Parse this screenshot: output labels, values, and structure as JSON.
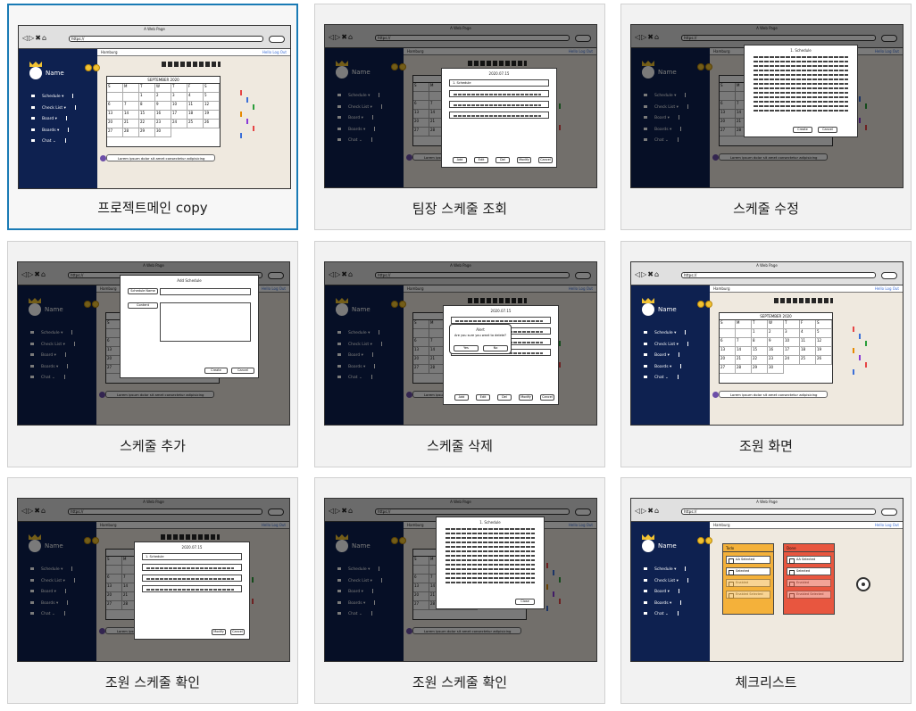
{
  "thumbs": [
    {
      "caption": "프로젝트메인 copy",
      "variant": "main",
      "selected": true
    },
    {
      "caption": "팀장 스케줄 조회",
      "variant": "list-dialog",
      "selected": false
    },
    {
      "caption": "스케줄 수정",
      "variant": "edit-dialog",
      "selected": false
    },
    {
      "caption": "스케줄 추가",
      "variant": "add-dialog",
      "selected": false
    },
    {
      "caption": "스케줄 삭제",
      "variant": "delete-dialog",
      "selected": false
    },
    {
      "caption": "조원 화면",
      "variant": "main",
      "selected": false
    },
    {
      "caption": "조원 스케줄 확인",
      "variant": "view-dialog",
      "selected": false
    },
    {
      "caption": "조원 스케줄 확인",
      "variant": "view-text-dialog",
      "selected": false
    },
    {
      "caption": "체크리스트",
      "variant": "checklist",
      "selected": false
    }
  ],
  "wire": {
    "window_title": "A Web Page",
    "url": "https://",
    "nav_glyphs": "◁▷✖⌂",
    "user_name": "Name",
    "menu": [
      "Schedule ▾",
      "Check List ▾",
      "Board ▾",
      "Boards ▾",
      "Chat ⌄"
    ],
    "header_left": "Hamburg",
    "header_links": "Hello  Log Out",
    "calendar_header": "SEPTEMBER 2020",
    "calendar_days": [
      "S",
      "M",
      "T",
      "W",
      "T",
      "F",
      "S"
    ],
    "calendar_numbers": [
      "",
      "",
      "1",
      "2",
      "3",
      "4",
      "5",
      "6",
      "7",
      "8",
      "9",
      "10",
      "11",
      "12",
      "13",
      "14",
      "15",
      "16",
      "17",
      "18",
      "19",
      "20",
      "21",
      "22",
      "23",
      "24",
      "25",
      "26",
      "27",
      "28",
      "29",
      "30"
    ],
    "comment": "Lorem ipsum dolor sit amet consectetur adipisicing",
    "list_title": "2020.07.15",
    "list_row_label": "1. Schedule",
    "edit_title": "1. Schedule",
    "add_title": "Add Schedule",
    "add_field_name": "Schedule Name",
    "add_field_content": "Content",
    "delete_title": "Alert",
    "delete_msg": "Are you sure you want to delete?",
    "yes": "Yes",
    "no": "No",
    "btn_add": "Add",
    "btn_edit": "Edit",
    "btn_delete": "Del",
    "btn_modify": "Modify",
    "btn_cancel": "Cancel",
    "btn_close": "Close",
    "btn_create": "Create",
    "checklist_todo": "Todo",
    "checklist_done": "Done",
    "checklist_items_todo": [
      "AA Selected",
      "Selected",
      "Enabled",
      "Enabled Selected"
    ],
    "checklist_items_done": [
      "AA Selected",
      "Selected",
      "Enabled",
      "Enabled Selected"
    ]
  }
}
